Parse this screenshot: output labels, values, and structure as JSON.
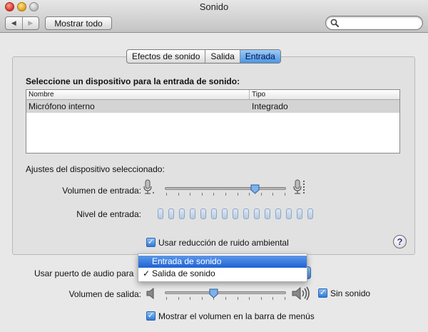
{
  "window": {
    "title": "Sonido"
  },
  "toolbar": {
    "back_glyph": "◀",
    "forward_glyph": "▶",
    "show_all_label": "Mostrar todo",
    "search_value": "",
    "search_placeholder": ""
  },
  "tabs": [
    {
      "label": "Efectos de sonido",
      "active": false
    },
    {
      "label": "Salida",
      "active": false
    },
    {
      "label": "Entrada",
      "active": true
    }
  ],
  "input": {
    "select_device_label": "Seleccione un dispositivo para la entrada de sonido:",
    "table": {
      "columns": [
        "Nombre",
        "Tipo"
      ],
      "rows": [
        {
          "name": "Micrófono interno",
          "type": "Integrado",
          "selected": true
        }
      ]
    },
    "device_settings_label": "Ajustes del dispositivo seleccionado:",
    "input_volume_label": "Volumen de entrada:",
    "input_volume_fraction": 0.74,
    "input_level_label": "Nivel de entrada:",
    "input_level_segments": 15,
    "input_level_active": 0,
    "noise_reduction_label": "Usar reducción de ruido ambiental",
    "noise_reduction_checked": true,
    "help_glyph": "?"
  },
  "bottom": {
    "audio_port_label": "Usar puerto de audio para",
    "audio_port_menu": [
      {
        "label": "Entrada de sonido",
        "highlighted": true,
        "checked": false
      },
      {
        "label": "Salida de sonido",
        "highlighted": false,
        "checked": true
      }
    ],
    "check_glyph": "✓",
    "output_volume_label": "Volumen de salida:",
    "output_volume_fraction": 0.4,
    "mute_label": "Sin sonido",
    "mute_checked": true,
    "show_volume_menubar_label": "Mostrar el volumen en la barra de menús",
    "show_volume_menubar_checked": true
  },
  "colors": {
    "accent": "#3d86df",
    "selection": "#d4d4d4",
    "level_segment": "#b8cbe2"
  }
}
